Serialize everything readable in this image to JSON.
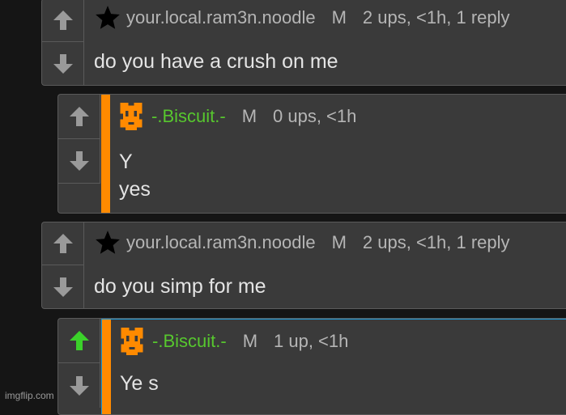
{
  "comments": [
    {
      "username": "your.local.ram3n.noodle",
      "mod_badge": "M",
      "stats": "2 ups, <1h, 1 reply",
      "text": "do you have a crush on me",
      "avatar": "star-icon",
      "upvoted": false
    },
    {
      "username": "-.Biscuit.-",
      "mod_badge": "M",
      "stats": "0 ups, <1h",
      "text": "Y\nyes",
      "avatar": "pixel-biscuit-avatar",
      "upvoted": false
    },
    {
      "username": "your.local.ram3n.noodle",
      "mod_badge": "M",
      "stats": "2 ups, <1h, 1 reply",
      "text": "do you simp for me",
      "avatar": "star-icon",
      "upvoted": false
    },
    {
      "username": "-.Biscuit.-",
      "mod_badge": "M",
      "stats": "1 up, <1h",
      "text": "Ye s",
      "avatar": "pixel-biscuit-avatar",
      "upvoted": true
    }
  ],
  "watermark": "imgflip.com",
  "colors": {
    "background": "#151515",
    "card": "#3a3a3a",
    "border": "#5a5a5a",
    "reply_stripe": "#ff8a00",
    "username_green": "#57c72e",
    "upvote_active": "#3bd12a",
    "arrow_inactive": "#9a9a9a",
    "highlight_border": "#1e9bd8"
  }
}
